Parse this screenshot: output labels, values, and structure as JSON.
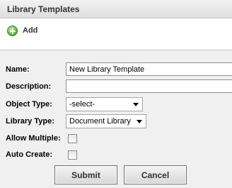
{
  "header": {
    "title": "Library Templates"
  },
  "toolbar": {
    "add_label": "Add",
    "add_icon": "add-circle-icon"
  },
  "form": {
    "name": {
      "label": "Name:",
      "value": "New Library Template"
    },
    "description": {
      "label": "Description:",
      "value": ""
    },
    "object_type": {
      "label": "Object Type:",
      "selected": "-select-"
    },
    "library_type": {
      "label": "Library Type:",
      "selected": "Document Library"
    },
    "allow_multiple": {
      "label": "Allow Multiple:",
      "checked": false
    },
    "auto_create": {
      "label": "Auto Create:",
      "checked": false
    }
  },
  "buttons": {
    "submit": "Submit",
    "cancel": "Cancel"
  }
}
